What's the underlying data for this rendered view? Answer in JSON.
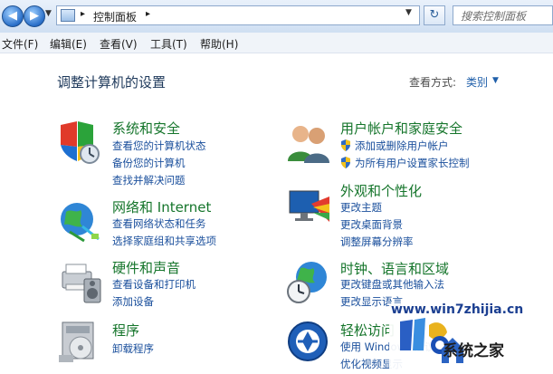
{
  "address": {
    "breadcrumb": "控制面板",
    "separator": "▸",
    "search_placeholder": "搜索控制面板"
  },
  "menu": [
    "文件(F)",
    "编辑(E)",
    "查看(V)",
    "工具(T)",
    "帮助(H)"
  ],
  "page": {
    "heading": "调整计算机的设置",
    "view_by_label": "查看方式:",
    "view_by_value": "类别"
  },
  "categories": [
    {
      "title": "系统和安全",
      "icon": "system-security-icon",
      "links": [
        "查看您的计算机状态",
        "备份您的计算机",
        "查找并解决问题"
      ]
    },
    {
      "title": "网络和 Internet",
      "icon": "network-icon",
      "links": [
        "查看网络状态和任务",
        "选择家庭组和共享选项"
      ]
    },
    {
      "title": "硬件和声音",
      "icon": "hardware-sound-icon",
      "links": [
        "查看设备和打印机",
        "添加设备"
      ]
    },
    {
      "title": "程序",
      "icon": "programs-icon",
      "links": [
        "卸载程序"
      ]
    },
    {
      "title": "用户帐户和家庭安全",
      "icon": "user-accounts-icon",
      "links": [
        "添加或删除用户帐户",
        "为所有用户设置家长控制"
      ]
    },
    {
      "title": "外观和个性化",
      "icon": "appearance-icon",
      "links": [
        "更改主题",
        "更改桌面背景",
        "调整屏幕分辨率"
      ]
    },
    {
      "title": "时钟、语言和区域",
      "icon": "clock-language-icon",
      "links": [
        "更改键盘或其他输入法",
        "更改显示语言"
      ]
    },
    {
      "title": "轻松访问",
      "icon": "ease-of-access-icon",
      "links": [
        "使用 Windows 建议的设置",
        "优化视频显示"
      ]
    }
  ],
  "watermark": {
    "url": "www.win7zhijia.cn",
    "text": "系统之家"
  },
  "colors": {
    "category_title": "#15752b",
    "link": "#1a4f9c",
    "heading": "#1e395b"
  }
}
